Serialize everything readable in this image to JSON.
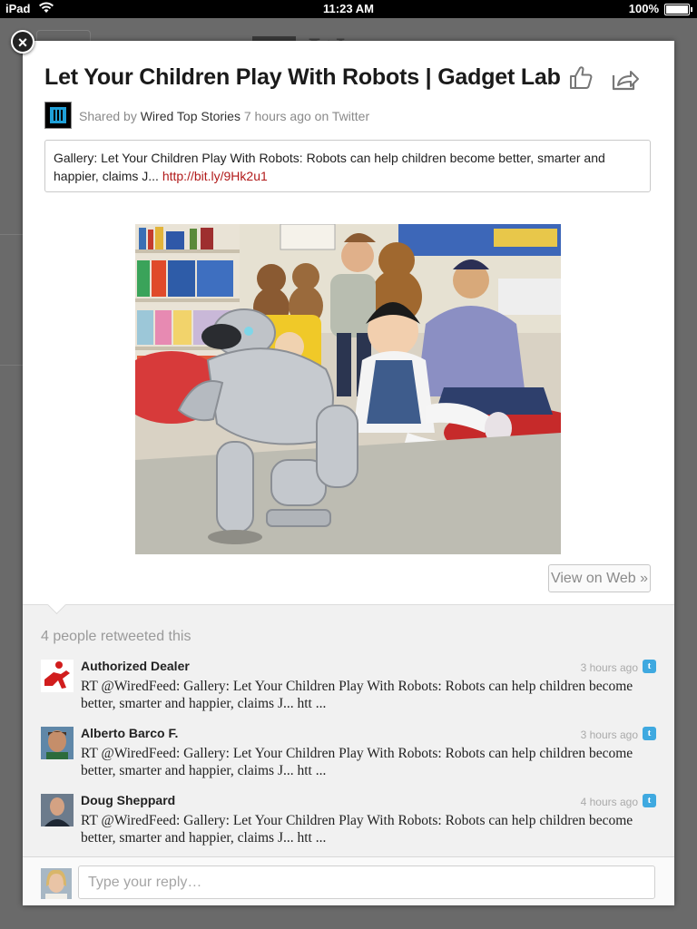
{
  "status_bar": {
    "device": "iPad",
    "time": "11:23 AM",
    "battery": "100%"
  },
  "story": {
    "title": "Let Your Children Play With Robots | Gadget Lab",
    "shared_prefix": "Shared by",
    "shared_by": "Wired Top Stories",
    "shared_suffix": "7 hours ago on Twitter",
    "tweet_text": "Gallery: Let Your Children Play With Robots: Robots can help children become better, smarter and happier, claims J...",
    "tweet_link": "http://bit.ly/9Hk2u1",
    "view_on_web": "View on Web »"
  },
  "retweets": {
    "count_label": "4 people retweeted this",
    "items": [
      {
        "name": "Authorized Dealer",
        "time": "3 hours ago",
        "text": "RT @WiredFeed: Gallery: Let Your Children Play With Robots: Robots can help children become better, smarter and happier, claims J... htt ..."
      },
      {
        "name": "Alberto Barco F.",
        "time": "3 hours ago",
        "text": "RT @WiredFeed: Gallery: Let Your Children Play With Robots: Robots can help children become better, smarter and happier, claims J... htt ..."
      },
      {
        "name": "Doug Sheppard",
        "time": "4 hours ago",
        "text": "RT @WiredFeed: Gallery: Let Your Children Play With Robots: Robots can help children become better, smarter and happier, claims J... htt ..."
      }
    ]
  },
  "reply": {
    "placeholder": "Type your reply…"
  },
  "icons": {
    "close": "close-icon",
    "like": "thumbs-up-icon",
    "share": "share-arrow-icon",
    "twitter": "twitter-icon",
    "wifi": "wifi-icon",
    "battery": "battery-icon"
  },
  "colors": {
    "link": "#b11a1a",
    "twitter": "#3fa9e0",
    "wired_logo": "#1fa0d8"
  }
}
